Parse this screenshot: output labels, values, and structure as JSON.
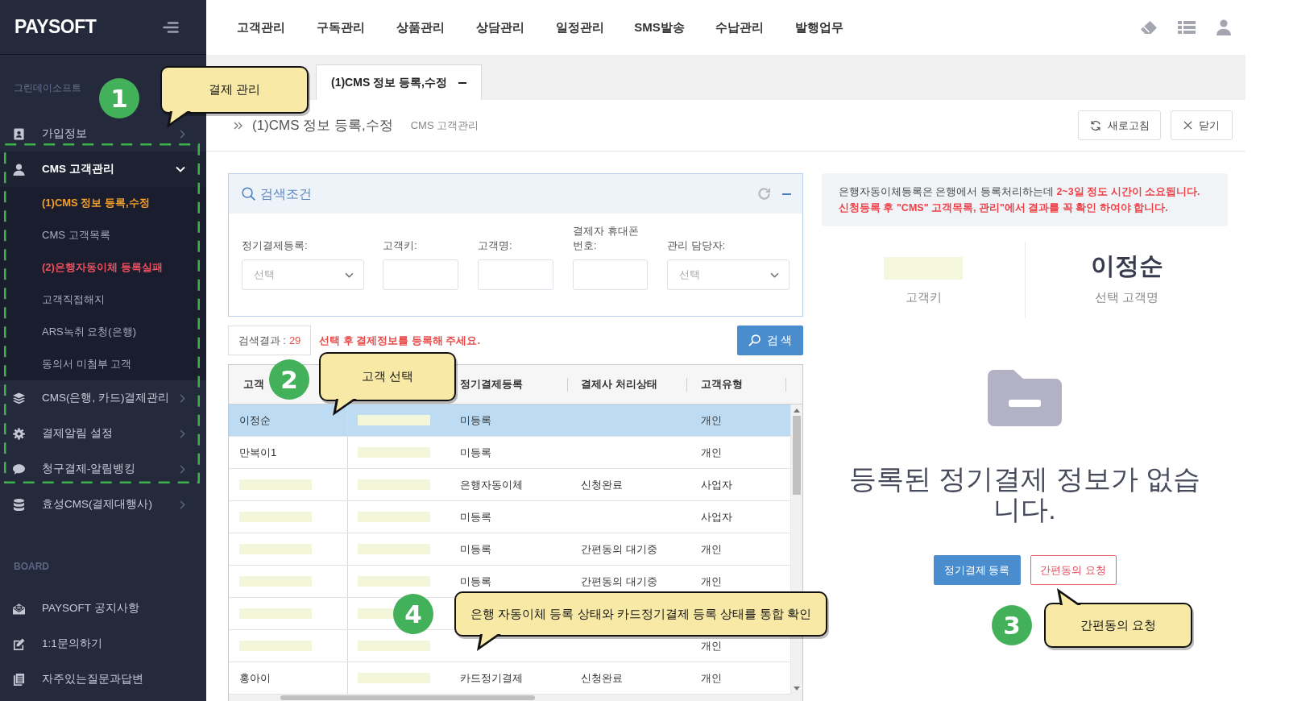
{
  "top_nav": {
    "items": [
      "고객관리",
      "구독관리",
      "상품관리",
      "상담관리",
      "일정관리",
      "SMS발송",
      "수납관리",
      "발행업무"
    ]
  },
  "sidebar": {
    "logo": "PAYSOFT",
    "group_label": "그린데이소프트",
    "items": [
      {
        "label": "가입정보",
        "expanded": false
      },
      {
        "label": "CMS 고객관리",
        "expanded": true,
        "children": [
          {
            "label": "(1)CMS 정보 등록,수정",
            "selected": true,
            "warning": false
          },
          {
            "label": "CMS 고객목록",
            "selected": false,
            "warning": false
          },
          {
            "label": "(2)은행자동이체 등록실패",
            "selected": false,
            "warning": true
          },
          {
            "label": "고객직접해지",
            "selected": false,
            "warning": false
          },
          {
            "label": "ARS녹취 요청(은행)",
            "selected": false,
            "warning": false
          },
          {
            "label": "동의서 미첨부 고객",
            "selected": false,
            "warning": false
          }
        ]
      },
      {
        "label": "CMS(은행, 카드)결제관리",
        "expanded": false
      },
      {
        "label": "결제알림 설정",
        "expanded": false
      },
      {
        "label": "청구결제-알림뱅킹",
        "expanded": false
      },
      {
        "label": "효성CMS(결제대행사)",
        "expanded": false
      }
    ],
    "board_label": "BOARD",
    "board_items": [
      "PAYSOFT 공지사항",
      "1:1문의하기",
      "자주있는질문과답변"
    ]
  },
  "tabs": [
    {
      "label": "(1)CMS 정보 등록,수정",
      "selected": true
    }
  ],
  "breadcrumb": {
    "title": "(1)CMS 정보 등록,수정",
    "parent": "CMS 고객관리",
    "buttons": [
      "새로고침",
      "닫기"
    ]
  },
  "search_panel": {
    "title": "검색조건",
    "fields": [
      {
        "kind": "select",
        "label": "정기결제등록:",
        "placeholder": "선택"
      },
      {
        "kind": "input",
        "label": "고객키:"
      },
      {
        "kind": "input",
        "label": "고객명:"
      },
      {
        "kind": "input",
        "label": "결제자 휴대폰 번호:"
      },
      {
        "kind": "select",
        "label": "관리 담당자:",
        "placeholder": "선택"
      }
    ]
  },
  "results": {
    "label": "검색결과 :",
    "count": "29",
    "hint": "선택 후 결제정보를 등록해 주세요.",
    "search_button": "검 색"
  },
  "table": {
    "columns": [
      {
        "label": "고객"
      },
      {},
      {
        "label": "정기결제등록"
      },
      {
        "label": "결제사 처리상태"
      },
      {
        "label": "고객유형"
      }
    ],
    "rows": [
      {
        "selected": true,
        "cells": [
          {
            "text": "이정순",
            "redacted": false
          },
          {
            "redacted": true
          },
          {
            "text": "미등록",
            "redacted": false
          },
          {
            "redacted": false
          },
          {
            "text": "개인",
            "redacted": false
          }
        ]
      },
      {
        "selected": false,
        "cells": [
          {
            "text": "만복이1",
            "redacted": false
          },
          {
            "redacted": true
          },
          {
            "text": "미등록",
            "redacted": false
          },
          {
            "redacted": false
          },
          {
            "text": "개인",
            "redacted": false
          }
        ]
      },
      {
        "selected": false,
        "cells": [
          {
            "redacted": true
          },
          {
            "redacted": true
          },
          {
            "text": "은행자동이체",
            "redacted": false
          },
          {
            "text": "신청완료",
            "redacted": false
          },
          {
            "text": "사업자",
            "redacted": false
          }
        ]
      },
      {
        "selected": false,
        "cells": [
          {
            "redacted": true
          },
          {
            "redacted": true
          },
          {
            "text": "미등록",
            "redacted": false
          },
          {
            "redacted": false
          },
          {
            "text": "사업자",
            "redacted": false
          }
        ]
      },
      {
        "selected": false,
        "cells": [
          {
            "redacted": true
          },
          {
            "redacted": true
          },
          {
            "text": "미등록",
            "redacted": false
          },
          {
            "text": "간편동의 대기중",
            "redacted": false
          },
          {
            "text": "개인",
            "redacted": false
          }
        ]
      },
      {
        "selected": false,
        "cells": [
          {
            "redacted": true
          },
          {
            "redacted": true
          },
          {
            "text": "미등록",
            "redacted": false
          },
          {
            "text": "간편동의 대기중",
            "redacted": false
          },
          {
            "text": "개인",
            "redacted": false
          }
        ]
      },
      {
        "selected": false,
        "cells": [
          {
            "redacted": true
          },
          {
            "redacted": true
          },
          {
            "redacted": false
          },
          {
            "redacted": false
          },
          {
            "redacted": false
          }
        ]
      },
      {
        "selected": false,
        "cells": [
          {
            "redacted": true
          },
          {
            "redacted": true
          },
          {
            "redacted": false
          },
          {
            "redacted": false
          },
          {
            "text": "개인",
            "redacted": false
          }
        ]
      },
      {
        "selected": false,
        "cells": [
          {
            "text": "홍아이",
            "redacted": false
          },
          {
            "redacted": true
          },
          {
            "text": "카드정기결제",
            "redacted": false
          },
          {
            "text": "신청완료",
            "redacted": false
          },
          {
            "text": "개인",
            "redacted": false
          }
        ]
      }
    ]
  },
  "detail": {
    "notice": [
      {
        "text": "은행자동이체등록은 은행에서 등록처리하는데 **2~3일 정도 시간이 소요됩니다.**",
        "emphasis": false
      },
      {
        "text": "신청등록 후 \"CMS\" 고객목록, 관리\"에서 결과를 꼭 확인 하여야 합니다.",
        "emphasis": true
      }
    ],
    "key_redacted": true,
    "key_label": "고객키",
    "customer_name": "이정순",
    "name_label": "선택 고객명",
    "empty_message": "등록된 정기결제 정보가 없습니다.",
    "buttons": [
      {
        "label": "정기결제 등록",
        "kind": "primary"
      },
      {
        "label": "간편동의 요청",
        "kind": "outline"
      }
    ]
  },
  "annotations": [
    {
      "number": "1",
      "text": "결제 관리"
    },
    {
      "number": "2",
      "text": "고객 선택"
    },
    {
      "number": "3",
      "text": "간편동의 요청"
    },
    {
      "number": "4",
      "text": "은행 자동이체 등록 상태와 카드정기결제 등록 상태를 통합 확인"
    }
  ]
}
